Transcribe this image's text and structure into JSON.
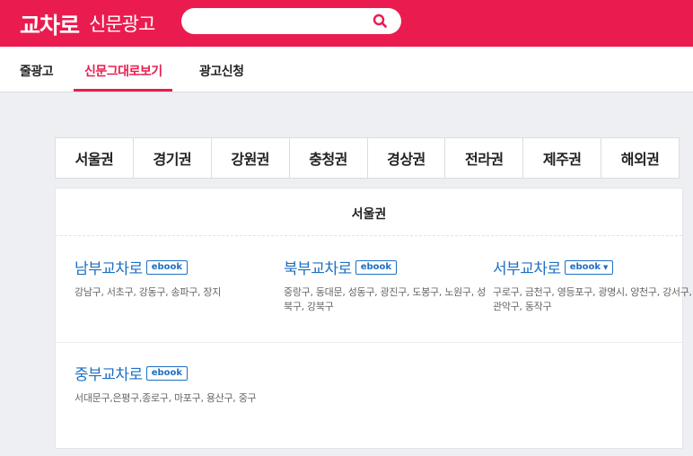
{
  "header": {
    "logo_main": "교차로",
    "logo_sub": "신문광고",
    "search_value": "",
    "search_icon": "search-icon",
    "brand_color": "#ea1c4f"
  },
  "tabs": [
    {
      "label": "줄광고"
    },
    {
      "label": "신문그대로보기",
      "active": true
    },
    {
      "label": "광고신청"
    }
  ],
  "regions": [
    "서울권",
    "경기권",
    "강원권",
    "충청권",
    "경상권",
    "전라권",
    "제주권",
    "해외권"
  ],
  "panel": {
    "title": "서울권",
    "papers": [
      {
        "name": "남부교차로",
        "badge": "ebook",
        "areas": "강남구, 서초구, 강동구, 송파구, 장지"
      },
      {
        "name": "북부교차로",
        "badge": "ebook",
        "areas": "중랑구, 동대문, 성동구, 광진구, 도봉구, 노원구, 성북구, 강북구"
      },
      {
        "name": "서부교차로",
        "badge": "ebook",
        "has_dropdown": true,
        "areas": "구로구, 금천구, 영등포구, 광명시, 양천구, 강서구, 관악구, 동작구"
      },
      {
        "name": "중부교차로",
        "badge": "ebook",
        "areas": "서대문구,은평구,종로구, 마포구, 용산구, 중구"
      }
    ]
  }
}
